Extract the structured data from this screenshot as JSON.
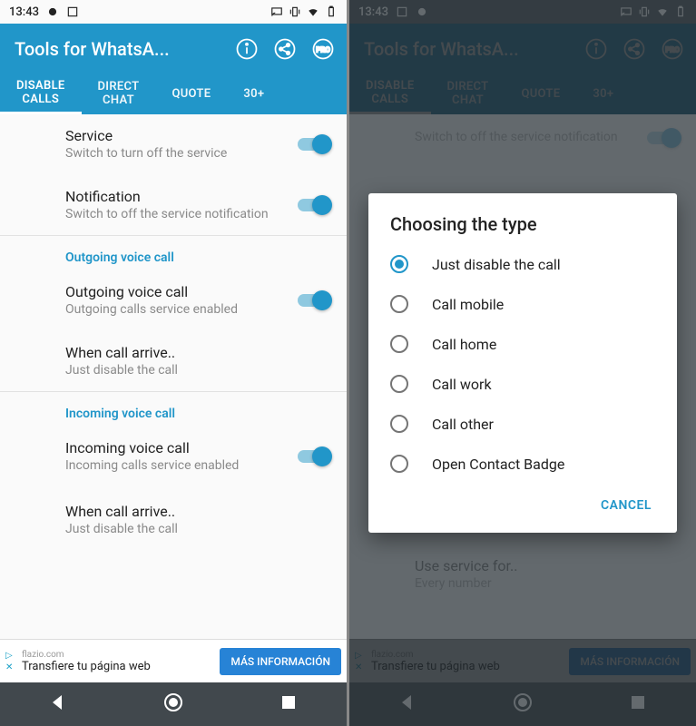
{
  "status": {
    "time": "13:43"
  },
  "header": {
    "title": "Tools for WhatsA...",
    "icons": {
      "info": "info-icon",
      "share": "share-icon",
      "pro": "PRO"
    }
  },
  "tabs": [
    {
      "label": "DISABLE\nCALLS",
      "active": true
    },
    {
      "label": "DIRECT\nCHAT",
      "active": false
    },
    {
      "label": "QUOTE",
      "active": false
    },
    {
      "label": "30+",
      "active": false
    }
  ],
  "settings": {
    "service": {
      "title": "Service",
      "sub": "Switch to turn off the service",
      "on": true
    },
    "notification": {
      "title": "Notification",
      "sub": "Switch to off the service notification",
      "on": true
    },
    "outgoing_head": "Outgoing voice call",
    "outgoing": {
      "title": "Outgoing voice call",
      "sub": "Outgoing calls service enabled",
      "on": true
    },
    "out_arrive": {
      "title": "When call arrive..",
      "sub": "Just disable the call"
    },
    "incoming_head": "Incoming voice call",
    "incoming": {
      "title": "Incoming voice call",
      "sub": "Incoming calls service enabled",
      "on": true
    },
    "in_arrive": {
      "title": "When call arrive..",
      "sub": "Just disable the call"
    },
    "use_service": {
      "title": "Use service for..",
      "sub": "Every number"
    }
  },
  "ad": {
    "domain": "flazio.com",
    "text": "Transfiere tu página web",
    "cta": "MÁS INFORMACIÓN"
  },
  "dialog": {
    "title": "Choosing the type",
    "options": [
      {
        "label": "Just disable the call",
        "selected": true
      },
      {
        "label": "Call mobile",
        "selected": false
      },
      {
        "label": "Call home",
        "selected": false
      },
      {
        "label": "Call work",
        "selected": false
      },
      {
        "label": "Call other",
        "selected": false
      },
      {
        "label": "Open Contact Badge",
        "selected": false
      }
    ],
    "cancel": "CANCEL"
  },
  "colors": {
    "accent": "#2196c9",
    "nav": "#41484d"
  }
}
